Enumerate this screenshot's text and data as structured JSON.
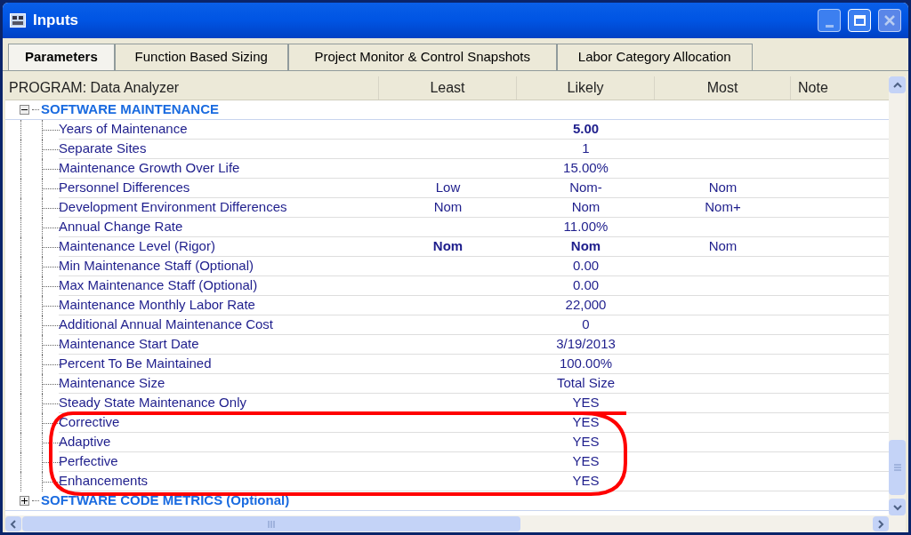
{
  "window": {
    "title": "Inputs"
  },
  "tabs": [
    {
      "label": "Parameters",
      "selected": true
    },
    {
      "label": "Function Based Sizing",
      "selected": false
    },
    {
      "label": "Project Monitor & Control Snapshots",
      "selected": false
    },
    {
      "label": "Labor Category Allocation",
      "selected": false
    }
  ],
  "table": {
    "columns": [
      "PROGRAM: Data Analyzer",
      "Least",
      "Likely",
      "Most",
      "Note"
    ],
    "sections": [
      {
        "title": "SOFTWARE MAINTENANCE",
        "expanded": true,
        "rows": [
          {
            "name": "Years of Maintenance",
            "likely": {
              "text": "5.00",
              "bold": true
            }
          },
          {
            "name": "Separate Sites",
            "likely": {
              "text": "1",
              "bold": false
            }
          },
          {
            "name": "Maintenance Growth Over Life",
            "likely": {
              "text": "15.00%",
              "bold": false
            }
          },
          {
            "name": "Personnel Differences",
            "least": {
              "text": "Low",
              "bold": false
            },
            "likely": {
              "text": "Nom-",
              "bold": false
            },
            "most": {
              "text": "Nom",
              "bold": false
            }
          },
          {
            "name": "Development Environment Differences",
            "least": {
              "text": "Nom",
              "bold": false
            },
            "likely": {
              "text": "Nom",
              "bold": false
            },
            "most": {
              "text": "Nom+",
              "bold": false
            }
          },
          {
            "name": "Annual Change Rate",
            "likely": {
              "text": "11.00%",
              "bold": false
            }
          },
          {
            "name": "Maintenance Level (Rigor)",
            "least": {
              "text": "Nom",
              "bold": true
            },
            "likely": {
              "text": "Nom",
              "bold": true
            },
            "most": {
              "text": "Nom",
              "bold": false
            }
          },
          {
            "name": "Min Maintenance Staff (Optional)",
            "likely": {
              "text": "0.00",
              "bold": false
            }
          },
          {
            "name": "Max Maintenance Staff (Optional)",
            "likely": {
              "text": "0.00",
              "bold": false
            }
          },
          {
            "name": "Maintenance Monthly Labor Rate",
            "likely": {
              "text": "22,000",
              "bold": false
            }
          },
          {
            "name": "Additional Annual Maintenance Cost",
            "likely": {
              "text": "0",
              "bold": false
            }
          },
          {
            "name": "Maintenance Start Date",
            "likely": {
              "text": "3/19/2013",
              "bold": false
            }
          },
          {
            "name": "Percent To Be Maintained",
            "likely": {
              "text": "100.00%",
              "bold": false
            }
          },
          {
            "name": "Maintenance Size",
            "likely": {
              "text": "Total Size",
              "bold": false
            }
          },
          {
            "name": "Steady State Maintenance Only",
            "likely": {
              "text": "YES",
              "bold": false
            }
          },
          {
            "name": "Corrective",
            "likely": {
              "text": "YES",
              "bold": false
            }
          },
          {
            "name": "Adaptive",
            "likely": {
              "text": "YES",
              "bold": false
            }
          },
          {
            "name": "Perfective",
            "likely": {
              "text": "YES",
              "bold": false
            }
          },
          {
            "name": "Enhancements",
            "likely": {
              "text": "YES",
              "bold": false
            }
          }
        ]
      },
      {
        "title": "SOFTWARE CODE METRICS (Optional)",
        "expanded": false
      }
    ]
  }
}
